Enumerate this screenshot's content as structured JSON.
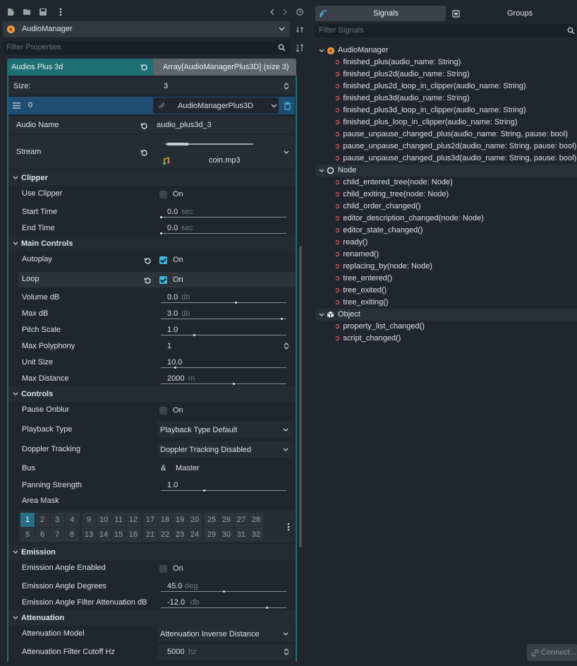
{
  "colors": {
    "accent": "#45b7d9",
    "header_teal": "#1e6f73",
    "signal_icon": "#e0605a",
    "selected_row": "#1f4d74"
  },
  "toolbar": {
    "icons": [
      "new-script-icon",
      "open-folder-icon",
      "save-icon",
      "menu-dots-icon",
      "history-back-icon",
      "history-forward-icon",
      "history-icon"
    ]
  },
  "node_selector": {
    "value": "AudioManager",
    "icon": "audio-icon"
  },
  "filter": {
    "placeholder": "Filter Properties"
  },
  "array_header": {
    "label": "Audios Plus 3d",
    "value": "Array[AudioManagerPlus3D] (size 3)"
  },
  "size": {
    "label": "Size:",
    "value": "3"
  },
  "element": {
    "index": "0",
    "type": "AudioManagerPlus3D"
  },
  "audio_name": {
    "label": "Audio Name",
    "value": "audio_plus3d_3"
  },
  "stream": {
    "label": "Stream",
    "file": "coin.mp3"
  },
  "sections": {
    "clipper": "Clipper",
    "main_controls": "Main Controls",
    "controls": "Controls",
    "emission": "Emission",
    "attenuation": "Attenuation"
  },
  "clipper": {
    "use_clipper": {
      "label": "Use Clipper",
      "value": "On"
    },
    "start_time": {
      "label": "Start Time",
      "value": "0.0",
      "unit": "sec"
    },
    "end_time": {
      "label": "End Time",
      "value": "0.0",
      "unit": "sec"
    }
  },
  "main": {
    "autoplay": {
      "label": "Autoplay",
      "value": "On",
      "checked": true
    },
    "loop": {
      "label": "Loop",
      "value": "On",
      "checked": true
    },
    "volume_db": {
      "label": "Volume dB",
      "value": "0.0",
      "unit": "db",
      "level": 0.6
    },
    "max_db": {
      "label": "Max dB",
      "value": "3.0",
      "unit": "db",
      "level": 0.97
    },
    "pitch_scale": {
      "label": "Pitch Scale",
      "value": "1.0",
      "level": 0.26
    },
    "max_polyphony": {
      "label": "Max Polyphony",
      "value": "1"
    },
    "unit_size": {
      "label": "Unit Size",
      "value": "10.0",
      "level": 0.11
    },
    "max_distance": {
      "label": "Max Distance",
      "value": "2000",
      "unit": "m",
      "level": 0.58
    }
  },
  "controls": {
    "pause_onblur": {
      "label": "Pause Onblur",
      "value": "On"
    },
    "playback_type": {
      "label": "Playback Type",
      "value": "Playback Type Default"
    },
    "doppler": {
      "label": "Doppler Tracking",
      "value": "Doppler Tracking Disabled"
    },
    "bus": {
      "label": "Bus",
      "value": "Master",
      "icon": "&"
    },
    "panning": {
      "label": "Panning Strength",
      "value": "1.0",
      "level": 0.34
    },
    "area_mask": {
      "label": "Area Mask",
      "row1": [
        "1",
        "2",
        "3",
        "4",
        "9",
        "10",
        "11",
        "12",
        "17",
        "18",
        "19",
        "20",
        "25",
        "26",
        "27",
        "28"
      ],
      "row2": [
        "5",
        "6",
        "7",
        "8",
        "13",
        "14",
        "15",
        "16",
        "21",
        "22",
        "23",
        "24",
        "29",
        "30",
        "31",
        "32"
      ]
    }
  },
  "emission": {
    "enabled": {
      "label": "Emission Angle Enabled",
      "value": "On"
    },
    "degrees": {
      "label": "Emission Angle Degrees",
      "value": "45.0",
      "unit": "deg",
      "level": 0.5
    },
    "filter_att": {
      "label": "Emission Angle Filter Attenuation dB",
      "value": "-12.0",
      "unit": "db",
      "level": 0.85
    }
  },
  "attenuation": {
    "model": {
      "label": "Attenuation Model",
      "value": "Attenuation Inverse Distance"
    },
    "cutoff": {
      "label": "Attenuation Filter Cutoff Hz",
      "value": "5000",
      "unit": "hz"
    }
  },
  "right": {
    "tabs": {
      "signals": "Signals",
      "groups": "Groups"
    },
    "filter_placeholder": "Filter Signals",
    "groups": [
      {
        "name": "AudioManager",
        "icon": "audio-icon",
        "signals": [
          "finished_plus(audio_name: String)",
          "finished_plus2d(audio_name: String)",
          "finished_plus2d_loop_in_clipper(audio_name: String)",
          "finished_plus3d(audio_name: String)",
          "finished_plus3d_loop_in_clipper(audio_name: String)",
          "finished_plus_loop_in_clipper(audio_name: String)",
          "pause_unpause_changed_plus(audio_name: String, pause: bool)",
          "pause_unpause_changed_plus2d(audio_name: String, pause: bool)",
          "pause_unpause_changed_plus3d(audio_name: String, pause: bool)"
        ]
      },
      {
        "name": "Node",
        "icon": "node-icon",
        "signals": [
          "child_entered_tree(node: Node)",
          "child_exiting_tree(node: Node)",
          "child_order_changed()",
          "editor_description_changed(node: Node)",
          "editor_state_changed()",
          "ready()",
          "renamed()",
          "replacing_by(node: Node)",
          "tree_entered()",
          "tree_exited()",
          "tree_exiting()"
        ]
      },
      {
        "name": "Object",
        "icon": "object-icon",
        "signals": [
          "property_list_changed()",
          "script_changed()"
        ]
      }
    ],
    "connect_button": "Connect..."
  }
}
